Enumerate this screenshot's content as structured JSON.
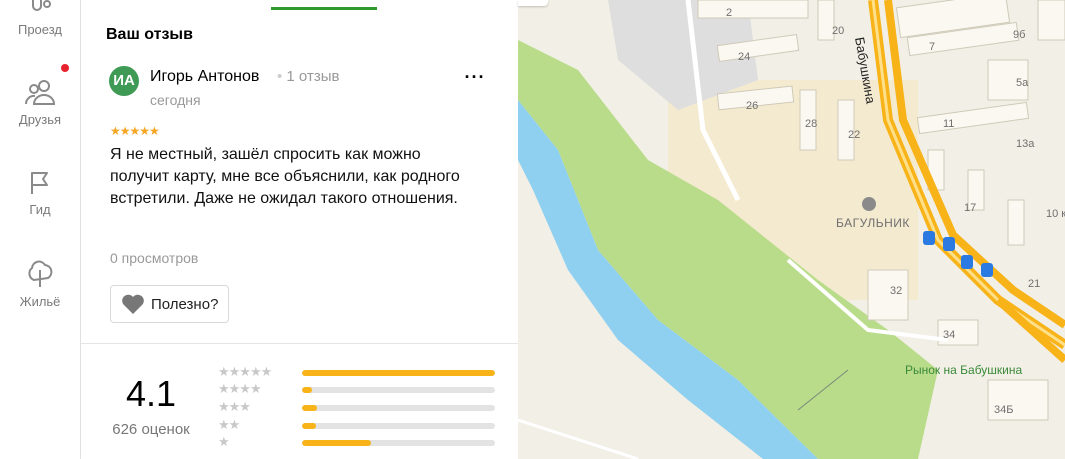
{
  "nav": {
    "items": [
      {
        "label": "Проезд",
        "icon": "route-icon"
      },
      {
        "label": "Друзья",
        "icon": "friends-icon",
        "badge": true
      },
      {
        "label": "Гид",
        "icon": "flag-icon"
      },
      {
        "label": "Жильё",
        "icon": "tree-house-icon"
      }
    ]
  },
  "review": {
    "section_title": "Ваш отзыв",
    "avatar_initials": "ИА",
    "author": "Игорь Антонов",
    "author_reviews": "1 отзыв",
    "date": "сегодня",
    "rating": 5,
    "text": "Я не местный, зашёл спросить как можно получит карту, мне все объяснили, как родного встретили. Даже не ожидал такого отношения.",
    "views": "0 просмотров",
    "useful_label": "Полезно?",
    "more_label": "···"
  },
  "summary": {
    "rating": "4.1",
    "count": "626 оценок",
    "distribution": [
      {
        "stars": "★★★★★",
        "fraction": 1.0
      },
      {
        "stars": "★★★★",
        "fraction": 0.05
      },
      {
        "stars": "★★★",
        "fraction": 0.08
      },
      {
        "stars": "★★",
        "fraction": 0.07
      },
      {
        "stars": "★",
        "fraction": 0.36
      }
    ]
  },
  "map": {
    "street_name": "Бабушкина",
    "poi": "БАГУЛЬНИК",
    "market": "Рынок на Бабушкина",
    "house_numbers": [
      "2",
      "20",
      "9б",
      "24",
      "7",
      "5а",
      "26",
      "28",
      "22",
      "11",
      "13а",
      "17",
      "10 к",
      "32",
      "21",
      "34",
      "34Б"
    ]
  },
  "colors": {
    "accent_green": "#2e9a2e",
    "avatar_green": "#3e9a55",
    "star_yellow": "#f5a623",
    "bar_yellow": "#f7b318",
    "map_road": "#f7b318",
    "river": "#8fd0f0",
    "park": "#b9dc8a"
  }
}
